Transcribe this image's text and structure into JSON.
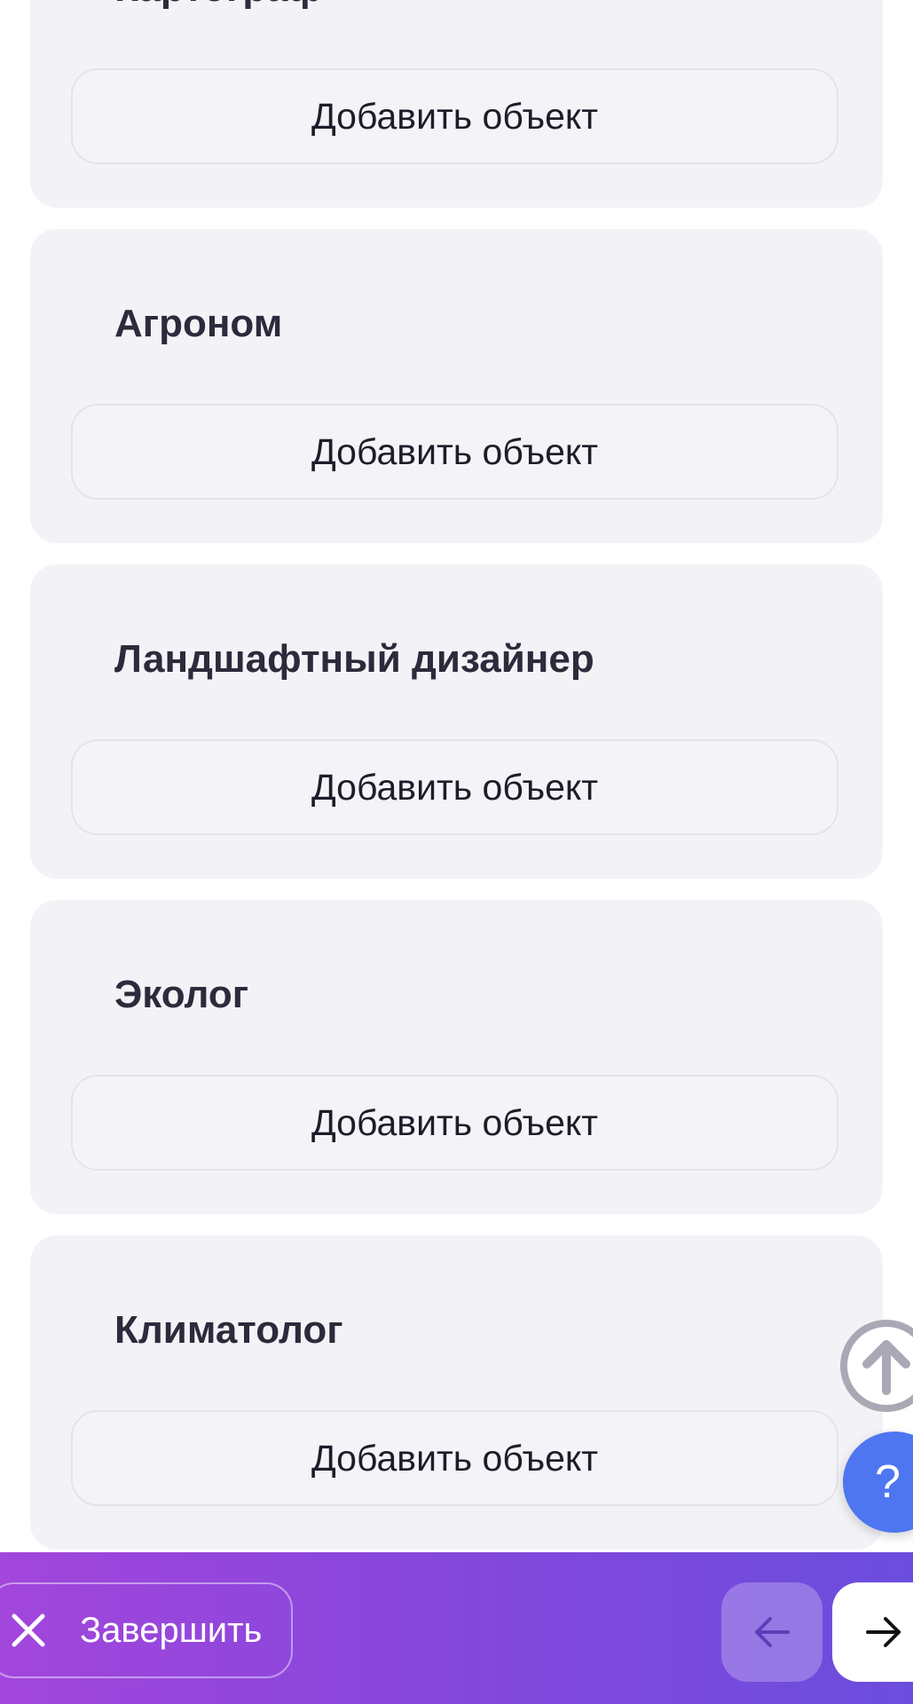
{
  "cards": [
    {
      "title": "Картограф",
      "button_label": "Добавить объект"
    },
    {
      "title": "Агроном",
      "button_label": "Добавить объект"
    },
    {
      "title": "Ландшафтный дизайнер",
      "button_label": "Добавить объект"
    },
    {
      "title": "Эколог",
      "button_label": "Добавить объект"
    },
    {
      "title": "Климатолог",
      "button_label": "Добавить объект"
    }
  ],
  "fab": {
    "scroll_top_icon": "arrow-up-icon",
    "help_label": "?"
  },
  "footer": {
    "finish_label": "Завершить",
    "finish_icon": "close-icon",
    "prev_icon": "arrow-left-icon",
    "next_icon": "arrow-right-icon"
  },
  "colors": {
    "card_bg": "#f3f3f7",
    "title_text": "#2b2b3c",
    "help_fab": "#4d76f0",
    "footer_gradient_start": "#a246dc",
    "footer_gradient_end": "#6b4ddd"
  }
}
